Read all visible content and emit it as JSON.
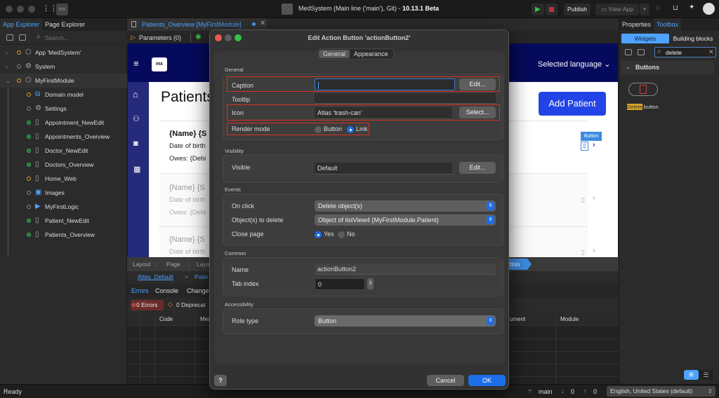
{
  "titlebar": {
    "app_name": "MedSystem (Main line ('main'), Git) - ",
    "version": "10.13.1 Beta",
    "publish_label": "Publish",
    "view_app_label": "View App",
    "mx_logo": "mx"
  },
  "left_panel": {
    "tabs": [
      "App Explorer",
      "Page Explorer"
    ],
    "search_placeholder": "Search...",
    "tree": [
      {
        "label": "App 'MedSystem'",
        "status": "orange",
        "icon": "app-icon",
        "level": 0,
        "expander": "collapsed"
      },
      {
        "label": "System",
        "status": "none",
        "icon": "system-icon",
        "level": 0,
        "expander": "collapsed"
      },
      {
        "label": "MyFirstModule",
        "status": "orange",
        "icon": "module-icon",
        "level": 0,
        "expander": "expanded"
      },
      {
        "label": "Domain model",
        "status": "orange",
        "icon": "domain-model-icon",
        "level": 1
      },
      {
        "label": "Settings",
        "status": "none",
        "icon": "gear-icon",
        "level": 1
      },
      {
        "label": "Appointment_NewEdit",
        "status": "green",
        "icon": "page-icon",
        "level": 1
      },
      {
        "label": "Appointments_Overview",
        "status": "green",
        "icon": "page-icon",
        "level": 1
      },
      {
        "label": "Doctor_NewEdit",
        "status": "green",
        "icon": "page-icon",
        "level": 1
      },
      {
        "label": "Doctors_Overview",
        "status": "green",
        "icon": "page-icon",
        "level": 1
      },
      {
        "label": "Home_Web",
        "status": "orange",
        "icon": "page-icon",
        "level": 1
      },
      {
        "label": "Images",
        "status": "none",
        "icon": "images-icon",
        "level": 1
      },
      {
        "label": "MyFirstLogic",
        "status": "none",
        "icon": "logic-icon",
        "level": 1
      },
      {
        "label": "Patient_NewEdit",
        "status": "green",
        "icon": "page-icon",
        "level": 1
      },
      {
        "label": "Patients_Overview",
        "status": "green",
        "icon": "page-icon",
        "level": 1
      }
    ]
  },
  "editor": {
    "tab_label": "Patients_Overview [MyFirstModule]",
    "parameters_label": "Parameters (0)",
    "canvas": {
      "logo": "mx",
      "language_label": "Selected language",
      "page_title": "Patients",
      "add_button": "Add Patient",
      "button_tag": "Button",
      "rows": [
        {
          "name": "{Name} {S",
          "dob": "Date of birth",
          "owes": "Owes: {Debi"
        },
        {
          "name": "{Name} {S",
          "dob": "Date of birth",
          "owes": "Owes: {Debi"
        },
        {
          "name": "{Name} {S",
          "dob": "Date of birth",
          "owes": ""
        }
      ]
    },
    "breadcrumb": [
      "Layout",
      "Page",
      "Layo",
      "tton"
    ],
    "path": [
      "Atlas_Default",
      ">",
      "Patie"
    ]
  },
  "bottom_panel": {
    "tabs": [
      "Errors",
      "Console",
      "Change"
    ],
    "errors_badge": "0 Errors",
    "deprecations_badge": "0 Deprecat",
    "columns": [
      "",
      "",
      "Code",
      "Mes",
      "ument",
      "Module"
    ]
  },
  "right_panel": {
    "tabs": [
      "Properties",
      "Toolbox"
    ],
    "subtabs": [
      "Widgets",
      "Building blocks"
    ],
    "search_value": "delete",
    "category": "Buttons",
    "widget_highlight": "Delete",
    "widget_rest": " button"
  },
  "dialog": {
    "title": "Edit Action Button 'actionButton2'",
    "tabs": [
      "General",
      "Appearance"
    ],
    "sections": {
      "general": {
        "label": "General",
        "caption_label": "Caption",
        "caption_value": "",
        "caption_edit": "Edit...",
        "tooltip_label": "Tooltip",
        "tooltip_value": "",
        "icon_label": "Icon",
        "icon_value": "Atlas 'trash-can'",
        "icon_select": "Select...",
        "render_mode_label": "Render mode",
        "render_options": [
          "Button",
          "Link"
        ],
        "render_selected": "Link"
      },
      "visibility": {
        "label": "Visibility",
        "visible_label": "Visible",
        "visible_value": "Default",
        "visible_edit": "Edit..."
      },
      "events": {
        "label": "Events",
        "on_click_label": "On click",
        "on_click_value": "Delete object(s)",
        "objects_label": "Object(s) to delete",
        "objects_value": "Object of listView4 (MyFirstModule.Patient)",
        "close_page_label": "Close page",
        "close_options": [
          "Yes",
          "No"
        ],
        "close_selected": "Yes"
      },
      "common": {
        "label": "Common",
        "name_label": "Name",
        "name_value": "actionButton2",
        "tab_index_label": "Tab index",
        "tab_index_value": "0"
      },
      "accessibility": {
        "label": "Accessibility",
        "role_label": "Role type",
        "role_value": "Button"
      }
    },
    "help_label": "?",
    "cancel_label": "Cancel",
    "ok_label": "OK"
  },
  "statusbar": {
    "status": "Ready",
    "branch": "main",
    "incoming": "0",
    "outgoing": "0",
    "language": "English, United States (default)"
  },
  "colors": {
    "accent": "#1d6ee8",
    "highlight_box": "#d9321f",
    "canvas_nav": "#050a5c",
    "add_button": "#2244e6"
  }
}
